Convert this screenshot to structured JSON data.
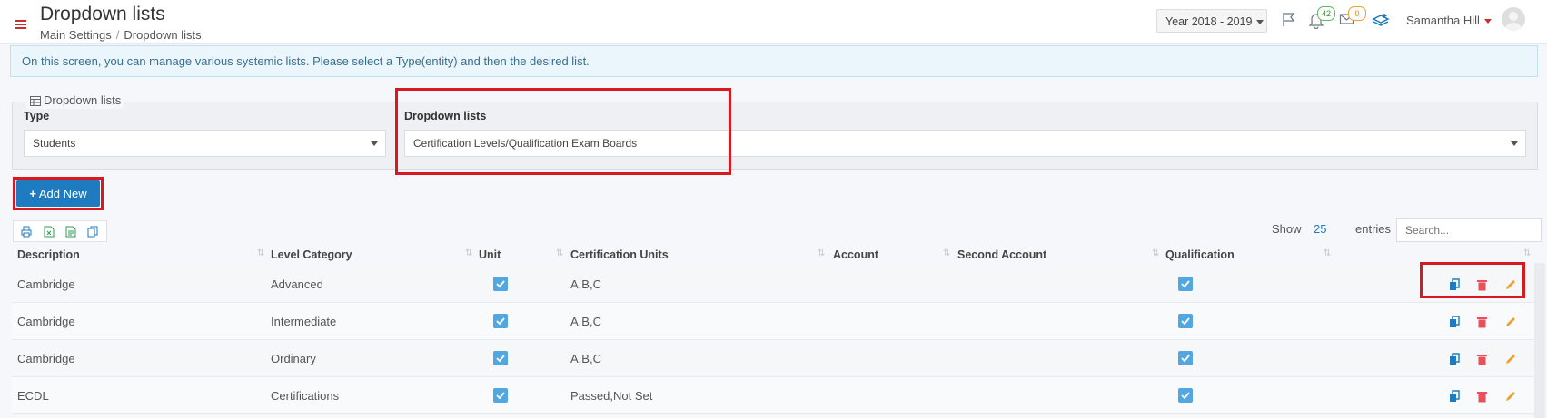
{
  "header": {
    "title": "Dropdown lists",
    "breadcrumb": [
      "Main Settings",
      "Dropdown lists"
    ],
    "breadcrumb_sep": "/",
    "year": "Year 2018 - 2019",
    "notifications_count": "42",
    "messages_count": "0",
    "user_name": "Samantha Hill",
    "icons": [
      "menu-icon",
      "flag-icon",
      "bell-icon",
      "envelope-icon",
      "layers-icon",
      "avatar"
    ]
  },
  "info": "On this screen, you can manage various systemic lists. Please select a Type(entity) and then the desired list.",
  "filters": {
    "legend": "Dropdown lists",
    "type_label": "Type",
    "type_value": "Students",
    "list_label": "Dropdown lists",
    "list_value": "Certification Levels/Qualification Exam Boards"
  },
  "toolbar": {
    "add_new": "Add New",
    "tool_icons": [
      "print-icon",
      "excel-icon",
      "csv-icon",
      "copy-icon"
    ],
    "show_label": "Show",
    "show_value": "25",
    "entries_label": "entries",
    "search_placeholder": "Search..."
  },
  "table": {
    "columns": [
      "Description",
      "Level Category",
      "Unit",
      "Certification Units",
      "Account",
      "Second Account",
      "Qualification"
    ],
    "rows": [
      {
        "description": "Cambridge",
        "level_category": "Advanced",
        "unit": true,
        "certification_units": "A,B,C",
        "account": "",
        "second_account": "",
        "qualification": true
      },
      {
        "description": "Cambridge",
        "level_category": "Intermediate",
        "unit": true,
        "certification_units": "A,B,C",
        "account": "",
        "second_account": "",
        "qualification": true
      },
      {
        "description": "Cambridge",
        "level_category": "Ordinary",
        "unit": true,
        "certification_units": "A,B,C",
        "account": "",
        "second_account": "",
        "qualification": true
      },
      {
        "description": "ECDL",
        "level_category": "Certifications",
        "unit": true,
        "certification_units": "Passed,Not Set",
        "account": "",
        "second_account": "",
        "qualification": true
      }
    ],
    "row_actions": [
      "copy-icon",
      "trash-icon",
      "pencil-icon"
    ]
  },
  "colors": {
    "accent": "#1f7bbf",
    "highlight_red": "#d9191f",
    "checkbox": "#52a7e0",
    "delete": "#e8505b",
    "edit": "#f0a030"
  }
}
